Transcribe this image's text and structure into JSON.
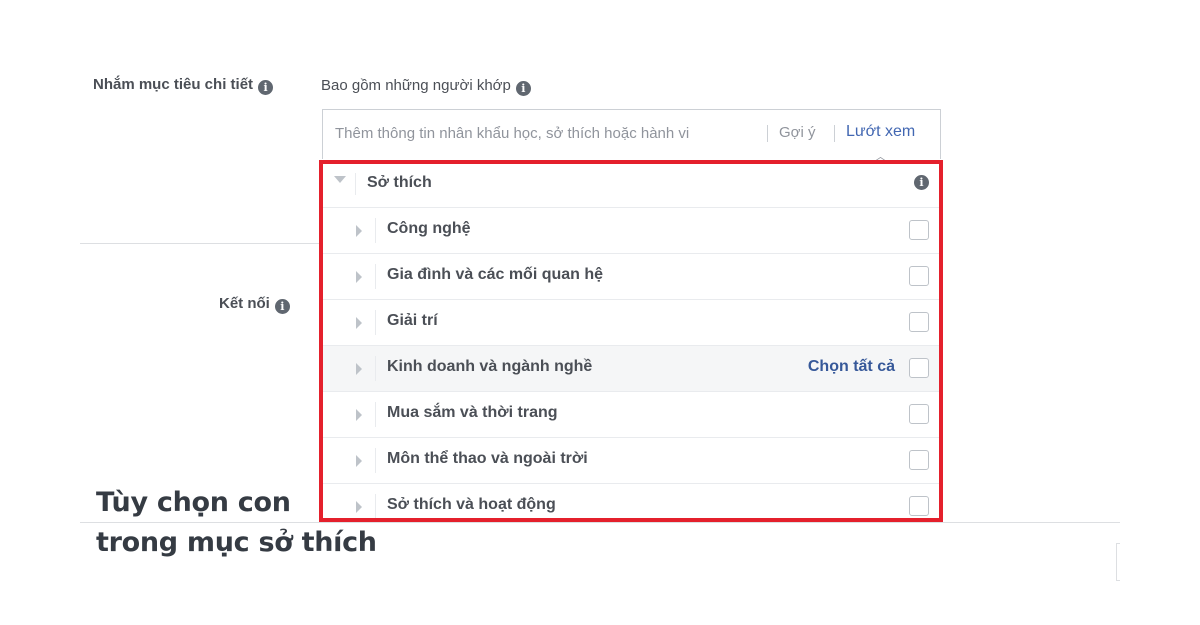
{
  "detailed_targeting": {
    "label": "Nhắm mục tiêu chi tiết",
    "include_label": "Bao gồm những người khớp",
    "search": {
      "placeholder": "Thêm thông tin nhân khẩu học, sở thích hoặc hành vi",
      "suggestions_label": "Gợi ý",
      "browse_label": "Lướt xem"
    }
  },
  "connections": {
    "label": "Kết nối"
  },
  "browse_panel": {
    "category_title": "Sở thích",
    "select_all_label": "Chọn tất cả",
    "items": [
      {
        "label": "Công nghệ",
        "checked": false
      },
      {
        "label": "Gia đình và các mối quan hệ",
        "checked": false
      },
      {
        "label": "Giải trí",
        "checked": false
      },
      {
        "label": "Kinh doanh và ngành nghề",
        "checked": false
      },
      {
        "label": "Mua sắm và thời trang",
        "checked": false
      },
      {
        "label": "Môn thể thao và ngoài trời",
        "checked": false
      },
      {
        "label": "Sở thích và hoạt động",
        "checked": false
      }
    ]
  },
  "caption": {
    "line1": "Tùy chọn con",
    "line2": "trong mục sở thích"
  },
  "colors": {
    "highlight_border": "#e4202c",
    "link_blue": "#4267b2"
  },
  "icons": {
    "info": "i"
  }
}
